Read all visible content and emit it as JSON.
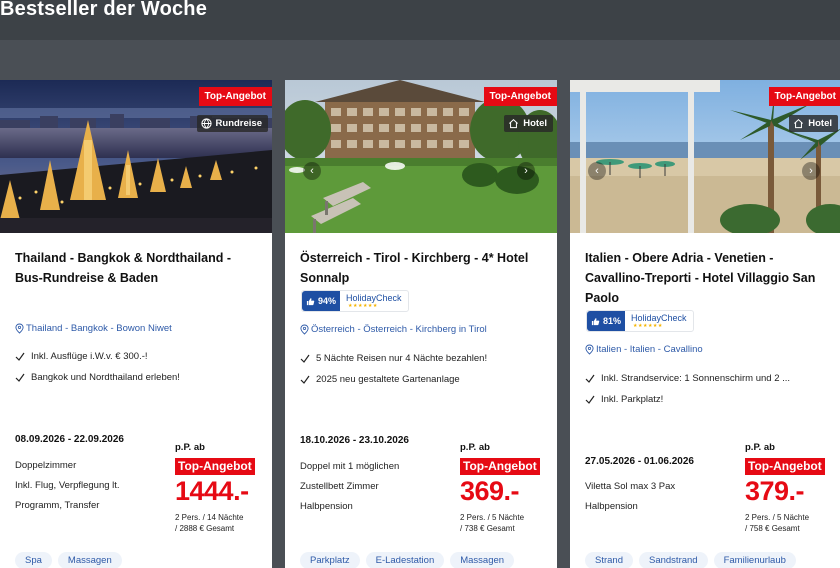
{
  "section_title": "Bestseller der Woche",
  "cards": [
    {
      "top_badge": "Top-Angebot",
      "type_badge": "Rundreise",
      "type_icon": "globe-icon",
      "title": "Thailand - Bangkok & Nordthailand - Bus-Rundreise & Baden",
      "location": "Thailand - Bangkok - Bowon Niwet",
      "features": [
        "Inkl. Ausflüge i.W.v. € 300.-!",
        "Bangkok und Nordthailand erleben!"
      ],
      "dates": "08.09.2026 - 22.09.2026",
      "details": [
        "Doppelzimmer",
        "Inkl. Flug, Verpflegung lt.",
        "Programm, Transfer"
      ],
      "price_prefix": "p.P. ab",
      "price_badge": "Top-Angebot",
      "price": "1444.-",
      "price_note_1": "2 Pers. / 14 Nächte",
      "price_note_2": "/ 2888 € Gesamt",
      "tags": [
        "Spa",
        "Massagen"
      ]
    },
    {
      "top_badge": "Top-Angebot",
      "type_badge": "Hotel",
      "type_icon": "house-icon",
      "title": "Österreich - Tirol - Kirchberg - 4* Hotel Sonnalp",
      "rating_score": "94%",
      "rating_brand": "HolidayCheck",
      "location": "Österreich - Österreich - Kirchberg in Tirol",
      "features": [
        "5 Nächte Reisen nur 4 Nächte bezahlen!",
        "2025 neu gestaltete Gartenanlage"
      ],
      "dates": "18.10.2026 - 23.10.2026",
      "details": [
        "Doppel mit 1 möglichen",
        "Zustellbett Zimmer",
        "Halbpension"
      ],
      "price_prefix": "p.P. ab",
      "price_badge": "Top-Angebot",
      "price": "369.-",
      "price_note_1": "2 Pers. / 5 Nächte",
      "price_note_2": "/ 738 € Gesamt",
      "tags": [
        "Parkplatz",
        "E-Ladestation",
        "Massagen"
      ]
    },
    {
      "top_badge": "Top-Angebot",
      "type_badge": "Hotel",
      "type_icon": "house-icon",
      "title": "Italien - Obere Adria - Venetien - Cavallino-Treporti - Hotel Villaggio San Paolo",
      "rating_score": "81%",
      "rating_brand": "HolidayCheck",
      "location": "Italien - Italien - Cavallino",
      "features": [
        "Inkl. Strandservice: 1 Sonnenschirm und 2 ...",
        "Inkl. Parkplatz!"
      ],
      "dates": "27.05.2026 - 01.06.2026",
      "details": [
        "Viletta Sol max 3 Pax",
        "Halbpension"
      ],
      "price_prefix": "p.P. ab",
      "price_badge": "Top-Angebot",
      "price": "379.-",
      "price_note_1": "2 Pers. / 5 Nächte",
      "price_note_2": "/ 758 € Gesamt",
      "tags": [
        "Strand",
        "Sandstrand",
        "Familienurlaub"
      ]
    }
  ],
  "colors": {
    "accent_red": "#e60a14",
    "link_blue": "#2e5aa8",
    "rating_blue": "#1e4fa3",
    "background": "#4a4f55"
  }
}
